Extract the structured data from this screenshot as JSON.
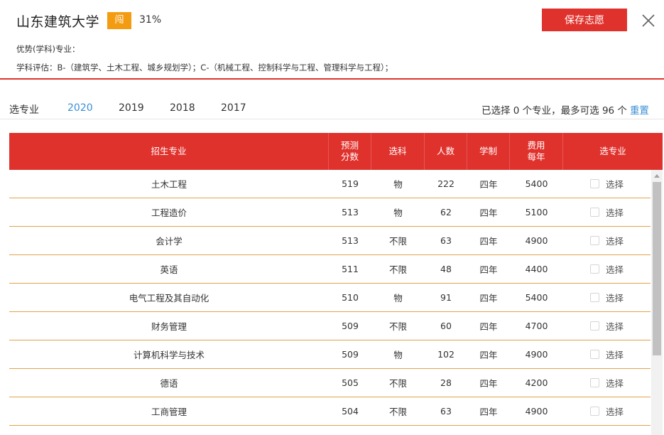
{
  "header": {
    "university": "山东建筑大学",
    "badge": "闯",
    "percent": "31%",
    "save_label": "保存志愿",
    "advantage_line": "优势(学科)专业：",
    "evaluation_line": "学科评估：B-（建筑学、土木工程、城乡规划学）；C-（机械工程、控制科学与工程、管理科学与工程）；"
  },
  "tabs": {
    "label": "选专业",
    "years": [
      "2020",
      "2019",
      "2018",
      "2017"
    ],
    "active": "2020"
  },
  "selection": {
    "status": "已选择 0 个专业，最多可选 96 个",
    "reset": "重置"
  },
  "table": {
    "columns": [
      "招生专业",
      "预测\n分数",
      "选科",
      "人数",
      "学制",
      "费用\n每年",
      "选专业"
    ],
    "column_lines": [
      [
        "招生专业"
      ],
      [
        "预测",
        "分数"
      ],
      [
        "选科"
      ],
      [
        "人数"
      ],
      [
        "学制"
      ],
      [
        "费用",
        "每年"
      ],
      [
        "选专业"
      ]
    ],
    "select_label": "选择",
    "rows": [
      {
        "major": "土木工程",
        "score": "519",
        "subject": "物",
        "count": "222",
        "years": "四年",
        "fee": "5400"
      },
      {
        "major": "工程造价",
        "score": "513",
        "subject": "物",
        "count": "62",
        "years": "四年",
        "fee": "5100"
      },
      {
        "major": "会计学",
        "score": "513",
        "subject": "不限",
        "count": "63",
        "years": "四年",
        "fee": "4900"
      },
      {
        "major": "英语",
        "score": "511",
        "subject": "不限",
        "count": "48",
        "years": "四年",
        "fee": "4400"
      },
      {
        "major": "电气工程及其自动化",
        "score": "510",
        "subject": "物",
        "count": "91",
        "years": "四年",
        "fee": "5400"
      },
      {
        "major": "财务管理",
        "score": "509",
        "subject": "不限",
        "count": "60",
        "years": "四年",
        "fee": "4700"
      },
      {
        "major": "计算机科学与技术",
        "score": "509",
        "subject": "物",
        "count": "102",
        "years": "四年",
        "fee": "4900"
      },
      {
        "major": "德语",
        "score": "505",
        "subject": "不限",
        "count": "28",
        "years": "四年",
        "fee": "4200"
      },
      {
        "major": "工商管理",
        "score": "504",
        "subject": "不限",
        "count": "63",
        "years": "四年",
        "fee": "4900"
      }
    ]
  },
  "colors": {
    "accent_red": "#e0322d",
    "badge_orange": "#f39c12",
    "link_blue": "#3b8fd6",
    "row_divider": "#e2a24b"
  }
}
